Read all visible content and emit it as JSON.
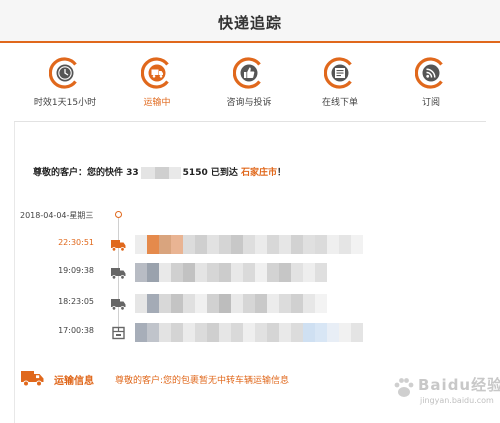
{
  "header": {
    "title": "快递追踪"
  },
  "nav": {
    "items": [
      {
        "label": "时效1天15小时",
        "icon": "clock-icon",
        "active": false
      },
      {
        "label": "运输中",
        "icon": "truck-icon",
        "active": true
      },
      {
        "label": "咨询与投诉",
        "icon": "thumbs-up-icon",
        "active": false
      },
      {
        "label": "在线下单",
        "icon": "order-form-icon",
        "active": false
      },
      {
        "label": "订阅",
        "icon": "rss-icon",
        "active": false
      }
    ]
  },
  "notice": {
    "prefix": "尊敬的客户：您的快件 33",
    "suffix": "5150 已到达",
    "city": "石家庄市",
    "end": "！"
  },
  "timeline": {
    "date": "2018-04-04-星期三",
    "events": [
      {
        "time": "22:30:51",
        "icon": "truck-icon"
      },
      {
        "time": "19:09:38",
        "icon": "truck-icon"
      },
      {
        "time": "18:23:05",
        "icon": "truck-icon"
      },
      {
        "time": "17:00:38",
        "icon": "package-icon"
      }
    ]
  },
  "transport": {
    "label": "运输信息",
    "message": "尊敬的客户:您的包裹暂无中转车辆运输信息"
  },
  "watermark": {
    "text": "Baidu经验",
    "url": "jingyan.baidu.com"
  },
  "colors": {
    "accent": "#e0681c",
    "text": "#333333",
    "muted": "#444444",
    "mask": "#dcdcdc"
  }
}
